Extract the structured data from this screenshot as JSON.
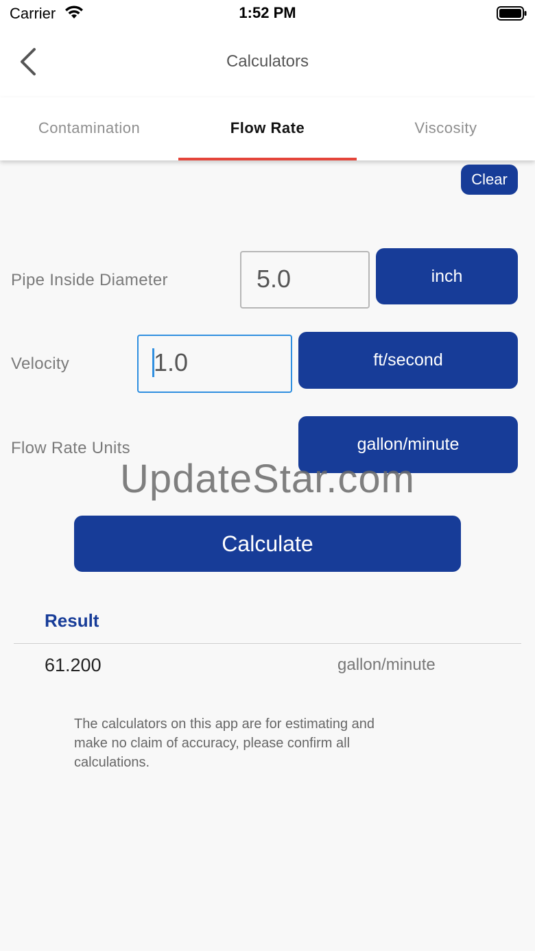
{
  "status_bar": {
    "carrier": "Carrier",
    "time": "1:52 PM",
    "wifi_icon": "wifi-icon",
    "battery_icon": "battery-icon"
  },
  "nav": {
    "title": "Calculators",
    "back_icon": "chevron-left-icon"
  },
  "tabs": [
    {
      "label": "Contamination",
      "active": false
    },
    {
      "label": "Flow Rate",
      "active": true
    },
    {
      "label": "Viscosity",
      "active": false
    }
  ],
  "clear_label": "Clear",
  "form": {
    "pipe_diameter": {
      "label": "Pipe Inside Diameter",
      "value": "5.0",
      "unit": "inch"
    },
    "velocity": {
      "label": "Velocity",
      "value": "1.0",
      "unit": "ft/second"
    },
    "flow_rate_units": {
      "label": "Flow Rate Units",
      "unit": "gallon/minute"
    }
  },
  "watermark": "UpdateStar.com",
  "calculate_label": "Calculate",
  "result": {
    "heading": "Result",
    "value": "61.200",
    "unit": "gallon/minute"
  },
  "disclaimer": "The calculators on this app are for estimating and\n make no claim of accuracy, please confirm all\ncalculations.",
  "colors": {
    "accent": "#173c98",
    "tab_indicator": "#e4453a",
    "focus": "#2f8fe0"
  }
}
